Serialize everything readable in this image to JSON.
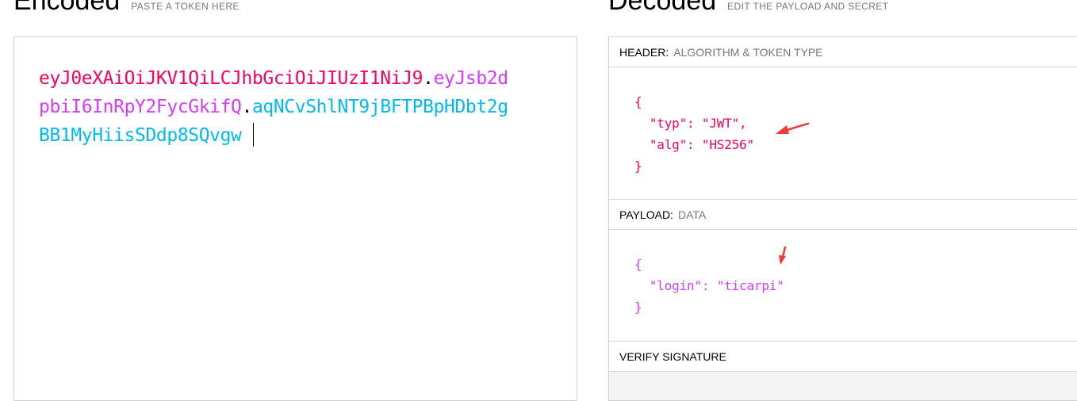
{
  "encoded": {
    "title": "Encoded",
    "subtitle": "PASTE A TOKEN HERE",
    "token": {
      "header": "eyJ0eXAiOiJKV1QiLCJhbGciOiJIUzI1NiJ9",
      "dot1": ".",
      "payload": "eyJsb2dpbiI6InRpY2FycGkifQ",
      "dot2": ".",
      "signature": "aqNCvShlNT9jBFTPBpHDbt2gBB1MyHiisSDdp8SQvgw"
    }
  },
  "decoded": {
    "title": "Decoded",
    "subtitle": "EDIT THE PAYLOAD AND SECRET",
    "header_section": {
      "label": "HEADER:",
      "hint": "ALGORITHM & TOKEN TYPE",
      "json_text": "{\n  \"typ\": \"JWT\",\n  \"alg\": \"HS256\"\n}"
    },
    "payload_section": {
      "label": "PAYLOAD:",
      "hint": "DATA",
      "json_text": "{\n  \"login\": \"ticarpi\"\n}"
    },
    "signature_section": {
      "label": "VERIFY SIGNATURE"
    }
  },
  "colors": {
    "header": "#fb015b",
    "payload": "#d63aff",
    "signature": "#00b9f1",
    "annotation_arrow": "#f03a3a"
  },
  "icons": [
    "annotation-arrow-icon"
  ]
}
